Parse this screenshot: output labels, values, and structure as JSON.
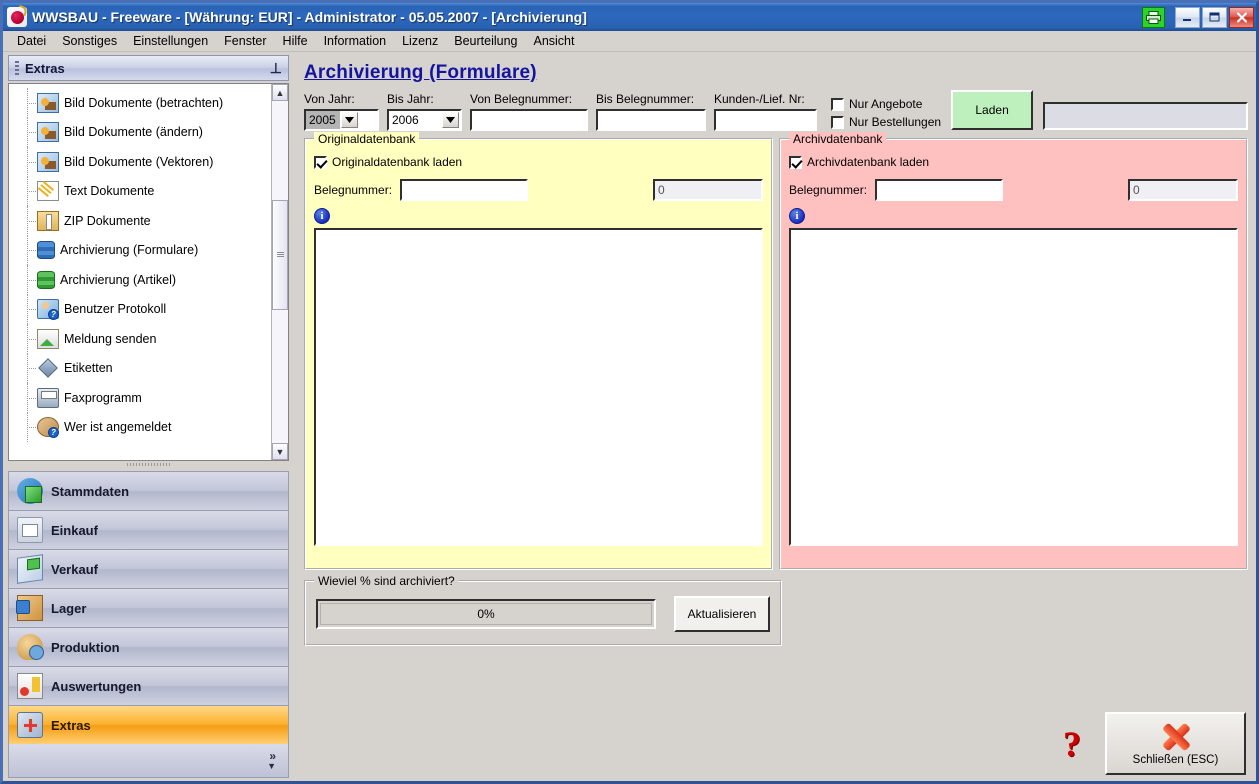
{
  "window": {
    "title": "WWSBAU - Freeware - [Währung: EUR] - Administrator - 05.05.2007 - [Archivierung]",
    "app_icon": "bomb-icon",
    "printer_icon": "printer-icon",
    "minimize_label": "_",
    "maximize_label": "❐",
    "close_label": "✕"
  },
  "menu": {
    "items": [
      {
        "label": "Datei"
      },
      {
        "label": "Sonstiges"
      },
      {
        "label": "Einstellungen"
      },
      {
        "label": "Fenster"
      },
      {
        "label": "Hilfe"
      },
      {
        "label": "Information"
      },
      {
        "label": "Lizenz"
      },
      {
        "label": "Beurteilung"
      },
      {
        "label": "Ansicht"
      }
    ]
  },
  "sidebar": {
    "header": {
      "title": "Extras",
      "pin_icon": "pin-icon"
    },
    "tree": [
      {
        "label": "Bild Dokumente (betrachten)",
        "icon": "image-document-icon"
      },
      {
        "label": "Bild Dokumente (ändern)",
        "icon": "image-document-edit-icon"
      },
      {
        "label": "Bild Dokumente (Vektoren)",
        "icon": "image-document-vector-icon"
      },
      {
        "label": "Text Dokumente",
        "icon": "text-document-icon"
      },
      {
        "label": "ZIP Dokumente",
        "icon": "zip-document-icon"
      },
      {
        "label": "Archivierung (Formulare)",
        "icon": "database-blue-icon"
      },
      {
        "label": "Archivierung (Artikel)",
        "icon": "database-green-icon"
      },
      {
        "label": "Benutzer Protokoll",
        "icon": "user-protocol-icon"
      },
      {
        "label": "Meldung senden",
        "icon": "send-mail-icon"
      },
      {
        "label": "Etiketten",
        "icon": "label-icon"
      },
      {
        "label": "Faxprogramm",
        "icon": "fax-icon"
      },
      {
        "label": "Wer ist angemeldet",
        "icon": "who-is-logged-in-icon"
      }
    ],
    "scroll": {
      "up_icon": "chevron-up-icon",
      "down_icon": "chevron-down-icon"
    },
    "nav": [
      {
        "label": "Stammdaten",
        "icon": "master-data-icon",
        "active": false
      },
      {
        "label": "Einkauf",
        "icon": "purchasing-icon",
        "active": false
      },
      {
        "label": "Verkauf",
        "icon": "sales-icon",
        "active": false
      },
      {
        "label": "Lager",
        "icon": "warehouse-icon",
        "active": false
      },
      {
        "label": "Produktion",
        "icon": "production-icon",
        "active": false
      },
      {
        "label": "Auswertungen",
        "icon": "reports-icon",
        "active": false
      },
      {
        "label": "Extras",
        "icon": "extras-icon",
        "active": true
      }
    ],
    "footer": {
      "expand_icon": "double-chevron-right-icon",
      "more_icon": "chevron-down-icon"
    }
  },
  "page": {
    "title": "Archivierung (Formulare)",
    "filters": {
      "von_jahr_label": "Von Jahr:",
      "von_jahr_value": "2005",
      "bis_jahr_label": "Bis Jahr:",
      "bis_jahr_value": "2006",
      "von_beleg_label": "Von Belegnummer:",
      "von_beleg_value": "",
      "bis_beleg_label": "Bis Belegnummer:",
      "bis_beleg_value": "",
      "kunden_label": "Kunden-/Lief. Nr:",
      "kunden_value": "",
      "nur_angebote_label": "Nur Angebote",
      "nur_angebote_checked": false,
      "nur_bestellungen_label": "Nur Bestellungen",
      "nur_bestellungen_checked": false,
      "laden_label": "Laden",
      "status_value": ""
    },
    "original_panel": {
      "title": "Originaldatenbank",
      "checkbox_label": "Originaldatenbank laden",
      "checkbox_checked": true,
      "belegnummer_label": "Belegnummer:",
      "belegnummer_value": "",
      "count_value": "0",
      "info_icon": "info-icon",
      "bg_color": "#ffffc0"
    },
    "archive_panel": {
      "title": "Archivdatenbank",
      "checkbox_label": "Archivdatenbank laden",
      "checkbox_checked": true,
      "belegnummer_label": "Belegnummer:",
      "belegnummer_value": "",
      "count_value": "0",
      "info_icon": "info-icon",
      "bg_color": "#ffc0c0"
    },
    "percent_panel": {
      "title": "Wieviel % sind archiviert?",
      "progress_value": "0%",
      "refresh_label": "Aktualisieren"
    },
    "footer": {
      "help_icon": "question-mark-icon",
      "close_label": "Schließen (ESC)",
      "close_icon": "red-x-icon"
    }
  },
  "colors": {
    "accent_blue": "#1414a0",
    "title_bar": "#2a63b4",
    "nav_active": "#f59e15",
    "panel_yellow": "#ffffc0",
    "panel_pink": "#ffc0c0",
    "load_button_green": "#bdf0bd"
  }
}
